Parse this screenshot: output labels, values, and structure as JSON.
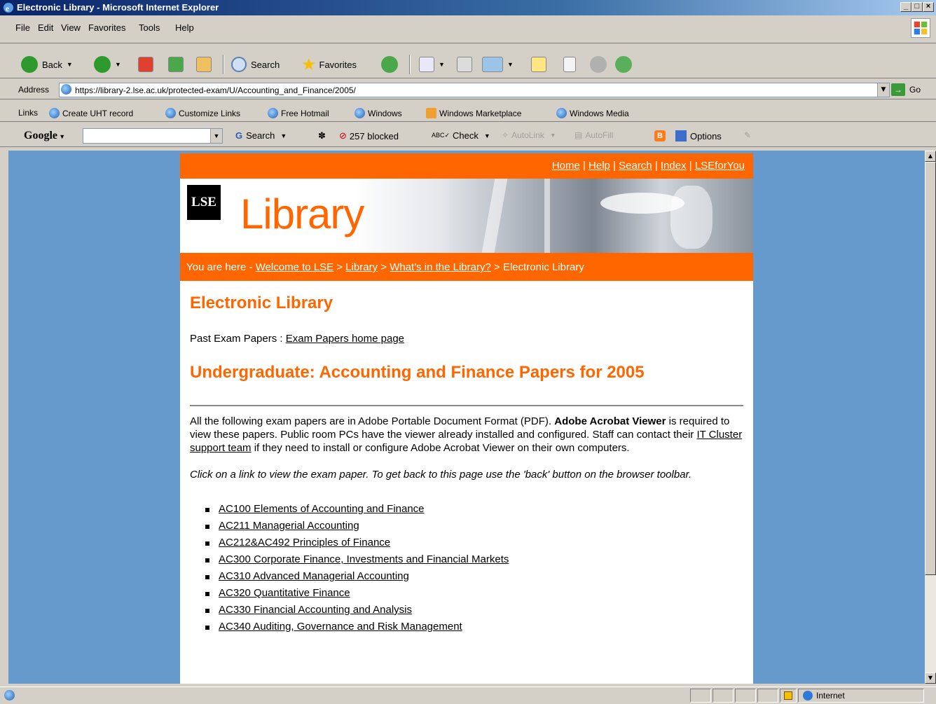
{
  "window": {
    "title": "Electronic Library - Microsoft Internet Explorer"
  },
  "menu": [
    "File",
    "Edit",
    "View",
    "Favorites",
    "Tools",
    "Help"
  ],
  "toolbar": {
    "back": "Back",
    "search": "Search",
    "favorites": "Favorites"
  },
  "address": {
    "label": "Address",
    "url": "https://library-2.lse.ac.uk/protected-exam/U/Accounting_and_Finance/2005/",
    "go": "Go"
  },
  "links": {
    "label": "Links",
    "items": [
      "Create UHT record",
      "Customize Links",
      "Free Hotmail",
      "Windows",
      "Windows Marketplace",
      "Windows Media"
    ]
  },
  "google": {
    "logo": "Google",
    "search": "Search",
    "blocked": "257 blocked",
    "check": "Check",
    "autolink": "AutoLink",
    "autofill": "AutoFill",
    "options": "Options"
  },
  "page": {
    "topnav": [
      "Home",
      "Help",
      "Search",
      "Index",
      "LSEforYou"
    ],
    "logo": "LSE",
    "banner_word": "Library",
    "breadcrumb": {
      "prefix": "You are here - ",
      "links": [
        "Welcome to LSE",
        "Library",
        "What's in the Library?"
      ],
      "current": "Electronic Library"
    },
    "heading": "Electronic Library",
    "past_label": "Past Exam Papers : ",
    "past_link": "Exam Papers home page",
    "subheading": "Undergraduate: Accounting and Finance Papers for 2005",
    "para1_a": "All the following exam papers are in Adobe Portable Document Format (PDF). ",
    "para1_bold": "Adobe Acrobat Viewer",
    "para1_b": " is required to view these papers. Public room PCs have the viewer already installed and configured. Staff can contact their ",
    "para1_link": "IT Cluster support team",
    "para1_c": " if they need to install or configure Adobe Acrobat Viewer on their own computers.",
    "para2": "Click on a link to view the exam paper. To get back to this page use the 'back' button on the browser toolbar.",
    "papers": [
      "AC100 Elements of Accounting and Finance",
      "AC211 Managerial Accounting",
      "AC212&AC492 Principles of Finance",
      "AC300 Corporate Finance, Investments and Financial Markets",
      "AC310 Advanced Managerial Accounting",
      "AC320 Quantitative Finance",
      "AC330 Financial Accounting and Analysis",
      "AC340 Auditing, Governance and Risk Management"
    ]
  },
  "status": {
    "zone": "Internet"
  }
}
